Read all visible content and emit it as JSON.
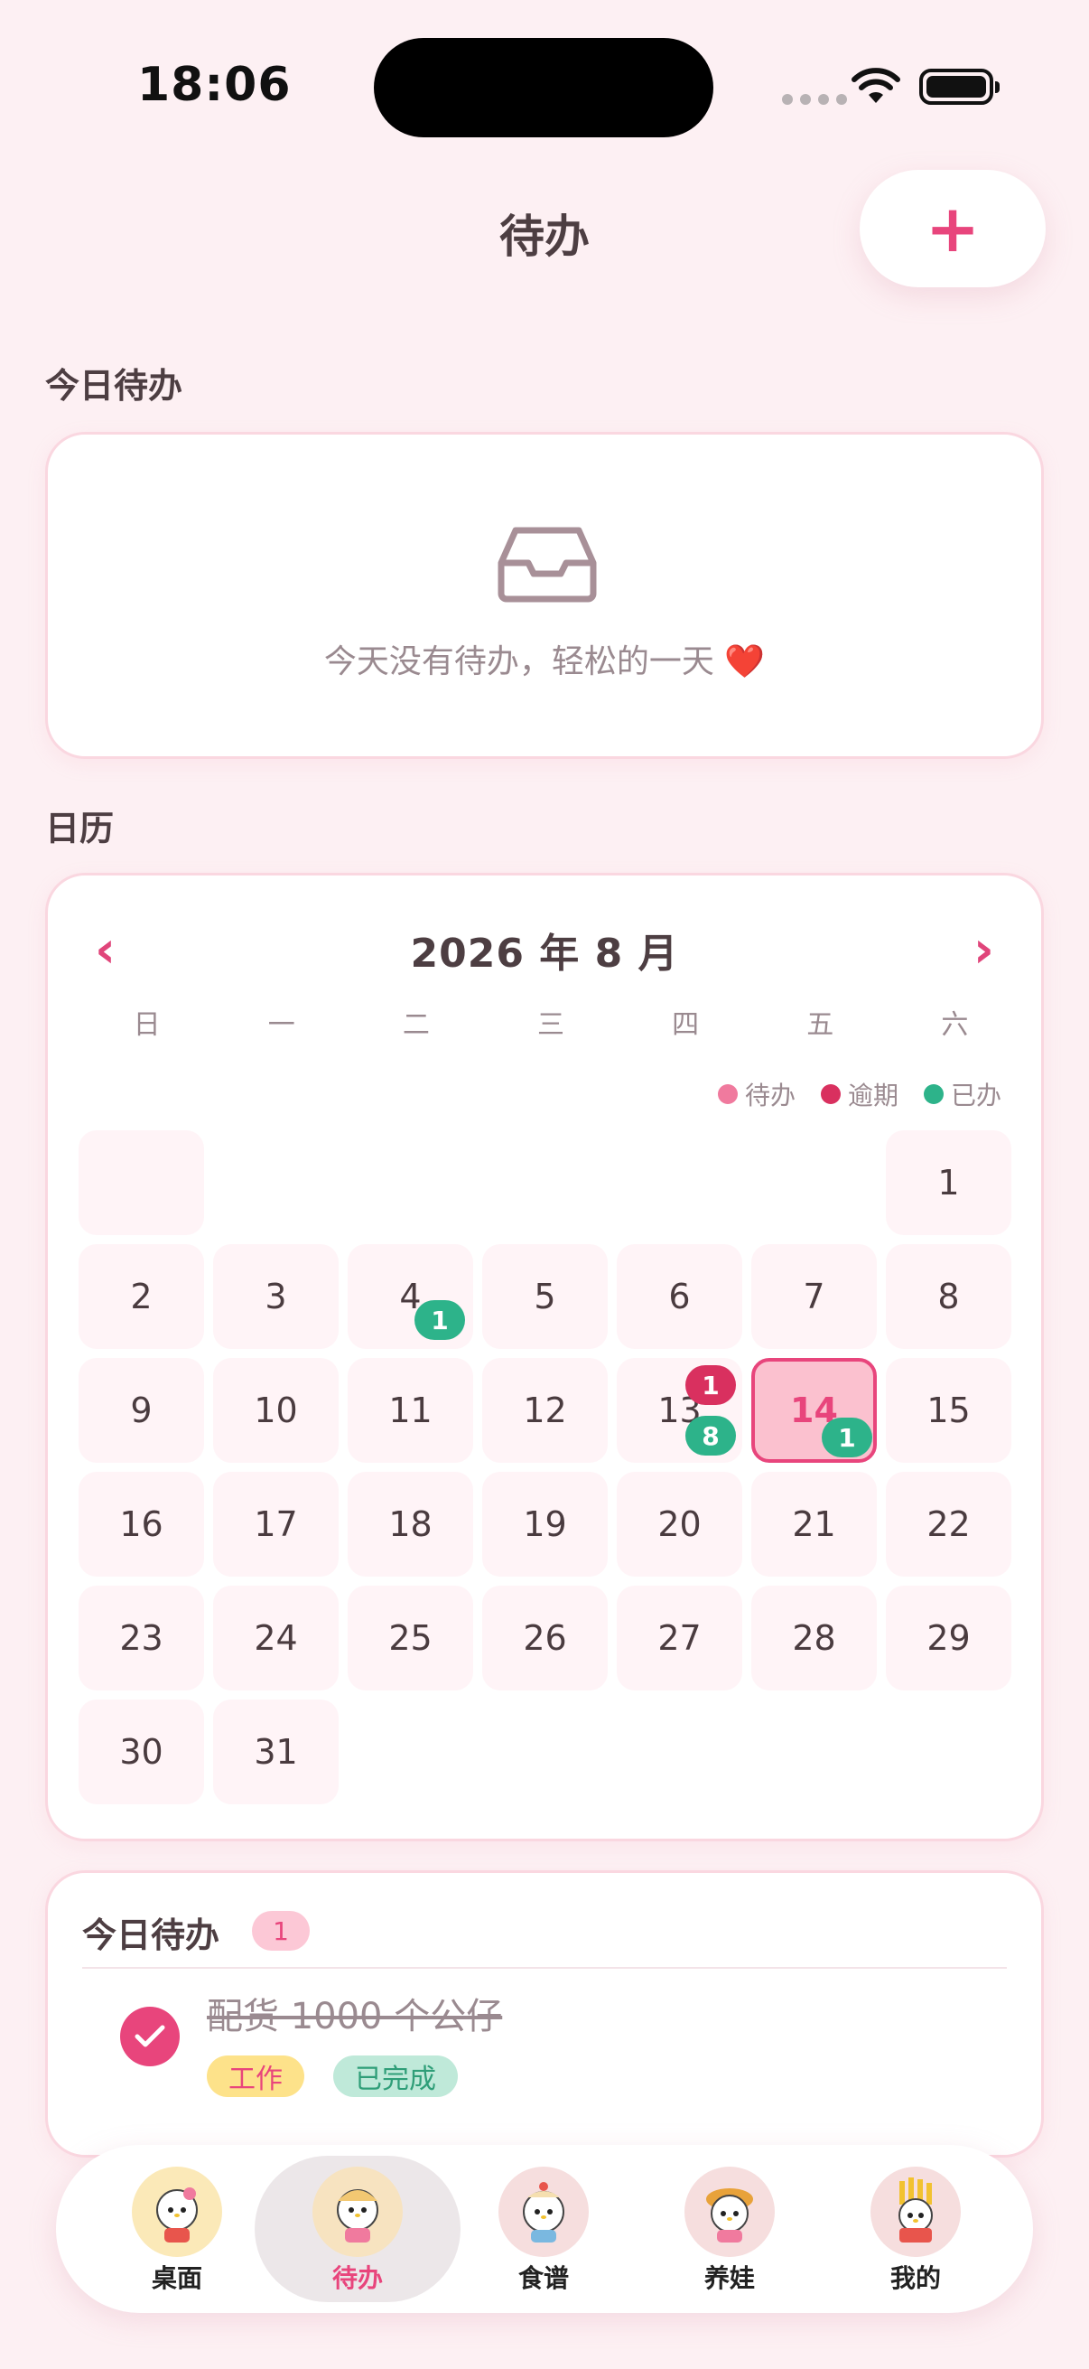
{
  "status_bar": {
    "time": "18:06"
  },
  "header": {
    "title": "待办",
    "add_label": "+"
  },
  "today_section": {
    "label": "今日待办",
    "empty_text": "今天没有待办，轻松的一天 ❤️"
  },
  "calendar_section": {
    "label": "日历",
    "title": "2026 年 8 月",
    "prev": "‹",
    "next": "›",
    "weekdays": [
      "日",
      "一",
      "二",
      "三",
      "四",
      "五",
      "六"
    ],
    "legend": [
      {
        "label": "待办",
        "color": "#f07a9e"
      },
      {
        "label": "逾期",
        "color": "#d9305f"
      },
      {
        "label": "已办",
        "color": "#2db38a"
      }
    ],
    "days": [
      "1",
      "2",
      "3",
      "4",
      "5",
      "6",
      "7",
      "8",
      "9",
      "10",
      "11",
      "12",
      "13",
      "14",
      "15",
      "16",
      "17",
      "18",
      "19",
      "20",
      "21",
      "22",
      "23",
      "24",
      "25",
      "26",
      "27",
      "28",
      "29",
      "30",
      "31"
    ],
    "badges": {
      "day4_done": "1",
      "day13_overdue": "1",
      "day13_done": "8",
      "day14_done": "1"
    }
  },
  "todo_list": {
    "title": "今日待办",
    "count": "1",
    "items": [
      {
        "text": "配货 1000 个公仔",
        "tags": [
          "工作",
          "已完成"
        ]
      }
    ]
  },
  "tabbar": {
    "tabs": [
      {
        "label": "桌面"
      },
      {
        "label": "待办"
      },
      {
        "label": "食谱"
      },
      {
        "label": "养娃"
      },
      {
        "label": "我的"
      }
    ],
    "active": "待办"
  }
}
